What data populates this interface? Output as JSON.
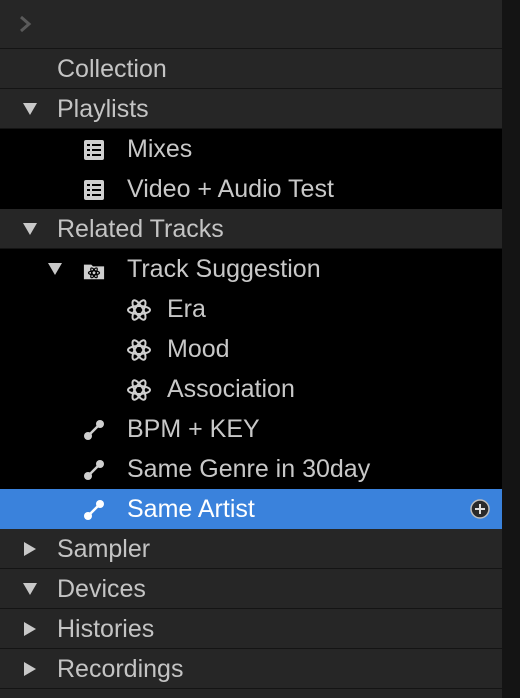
{
  "topbar": {
    "expand_icon": "chevron-right-icon"
  },
  "tree": {
    "collection": "Collection",
    "playlists": "Playlists",
    "mixes": "Mixes",
    "video_audio_test": "Video + Audio Test",
    "related_tracks": "Related Tracks",
    "track_suggestion": "Track Suggestion",
    "era": "Era",
    "mood": "Mood",
    "association": "Association",
    "bpm_key": "BPM + KEY",
    "same_genre": "Same Genre in 30day",
    "same_artist": "Same Artist",
    "sampler": "Sampler",
    "devices": "Devices",
    "histories": "Histories",
    "recordings": "Recordings"
  },
  "colors": {
    "selected": "#3a82dc",
    "background": "#262626",
    "child_background": "#000000"
  },
  "icons": {
    "playlist": "playlist-icon",
    "folder": "folder-icon",
    "atom": "atom-icon",
    "related": "related-link-icon",
    "add": "add-circle-icon"
  }
}
